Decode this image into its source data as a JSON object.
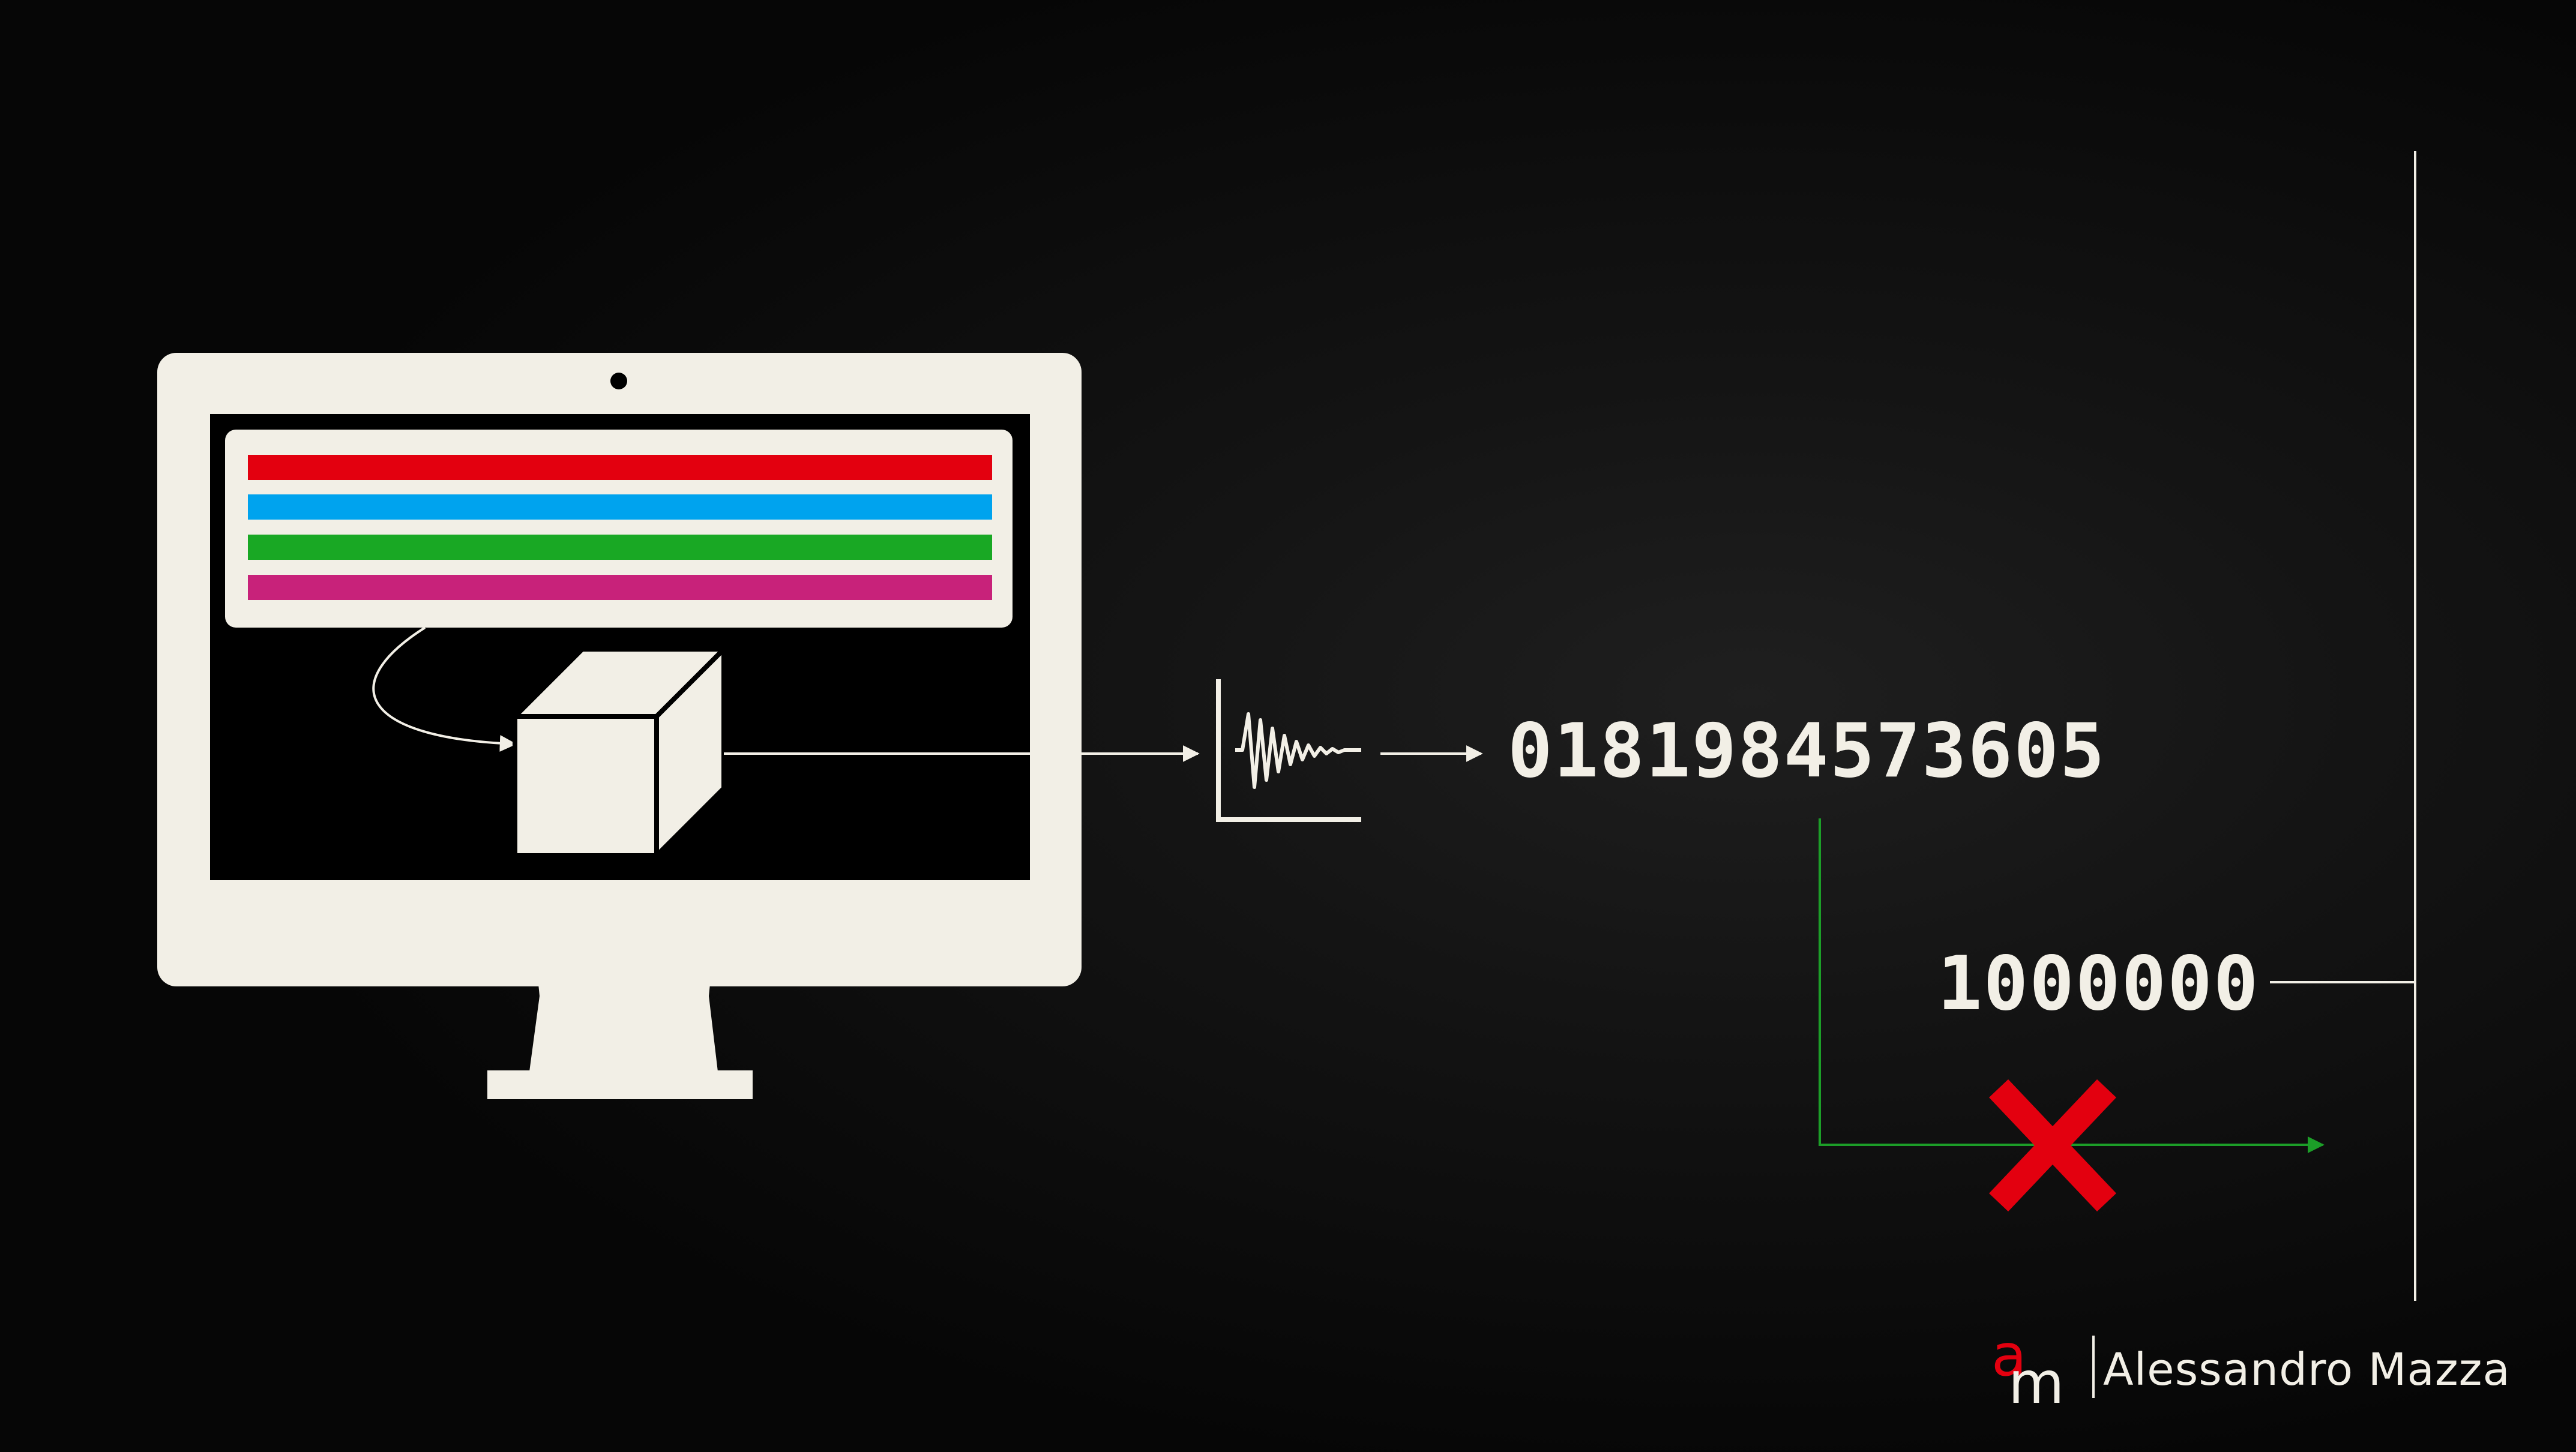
{
  "diagram": {
    "code_value": "0181984573605",
    "limit_value": "1000000",
    "author": "Alessandro Mazza",
    "logo_letters": "am",
    "colors": {
      "background": "#000000",
      "foreground": "#f2efe6",
      "bar_red": "#e3000f",
      "bar_blue": "#00a3ee",
      "bar_green": "#19a824",
      "bar_magenta": "#c8227a",
      "path_green": "#1c9e28",
      "cross_red": "#e3000f"
    },
    "icons": [
      "monitor-icon",
      "cube-icon",
      "waveform-icon",
      "cross-icon"
    ]
  }
}
